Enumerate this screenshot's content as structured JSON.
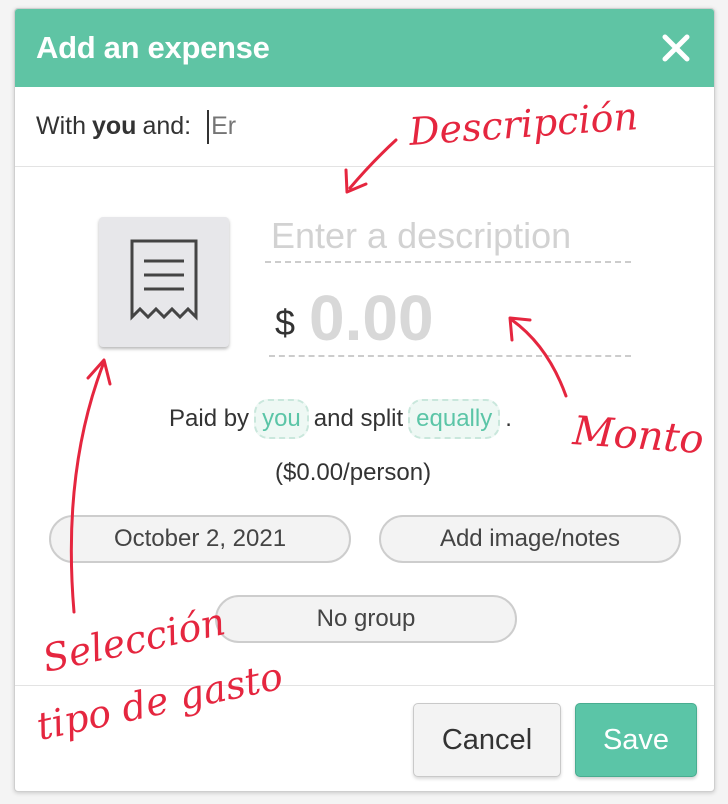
{
  "dialog": {
    "title": "Add an expense",
    "close_icon": "close-icon"
  },
  "with": {
    "prefix": "With",
    "you": "you",
    "suffix": "and:",
    "input_value": "Er"
  },
  "description": {
    "placeholder": "Enter a description"
  },
  "amount": {
    "currency": "$",
    "placeholder": "0.00"
  },
  "paid": {
    "paid_by": "Paid by",
    "payer": "you",
    "and_split": "and split",
    "split": "equally",
    "period": ".",
    "per_person": "($0.00/person)"
  },
  "buttons": {
    "date": "October 2, 2021",
    "notes": "Add image/notes",
    "group": "No group",
    "cancel": "Cancel",
    "save": "Save"
  },
  "annotations": {
    "descripcion": "Descripción",
    "monto": "Monto",
    "seleccion": "Selección",
    "tipo_gasto": "tipo de gasto"
  },
  "icons": {
    "category": "receipt-icon"
  },
  "colors": {
    "header": "#5fc4a4",
    "accent": "#5bc5a7",
    "annotation": "#e5263f"
  }
}
